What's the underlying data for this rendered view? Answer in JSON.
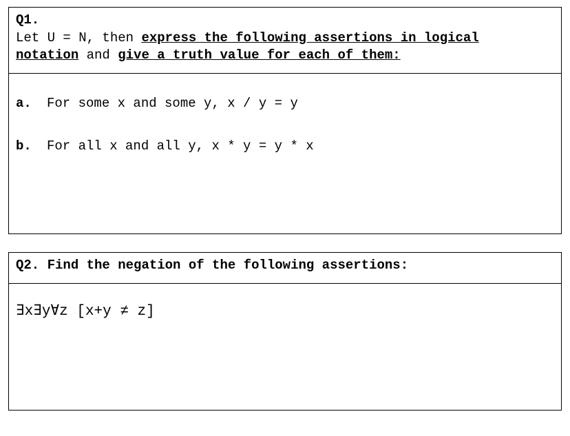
{
  "q1": {
    "label": "Q1.",
    "intro_plain": "Let U = N, then ",
    "intro_underlined_1": "express the following assertions in logical",
    "intro_underlined_2": "notation",
    "intro_plain_2": " and ",
    "intro_underlined_3": "give a truth value for each of them:",
    "parts": {
      "a": {
        "label": "a.",
        "text": "For some x and some y, x / y = y"
      },
      "b": {
        "label": "b.",
        "text": "For all x and all y, x * y  = y * x"
      }
    }
  },
  "q2": {
    "label": "Q2.",
    "header": " Find the negation of the following assertions:",
    "expression": "∃x∃y∀z [x+y ≠ z]"
  }
}
